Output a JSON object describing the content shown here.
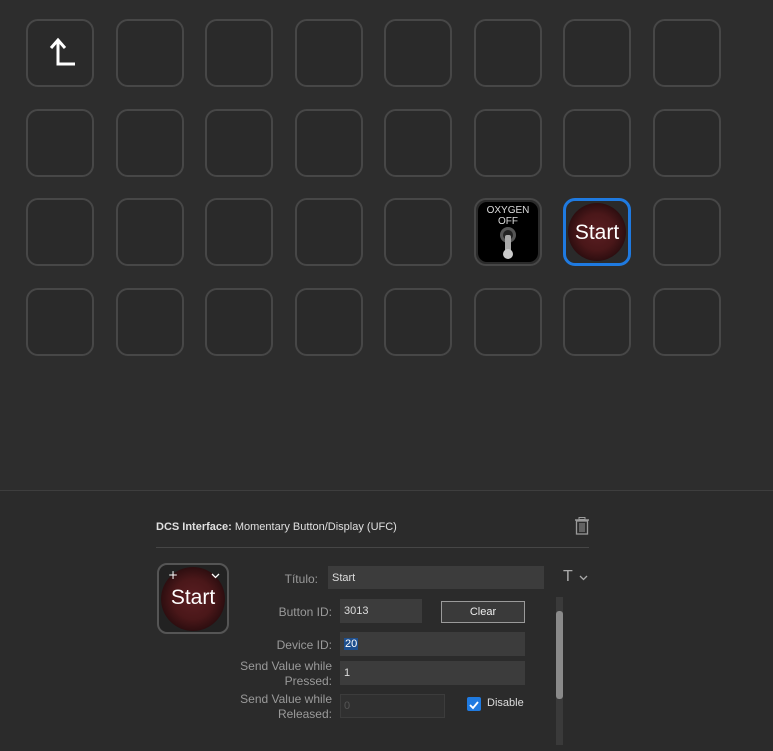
{
  "grid": {
    "oxygen_line1": "OXYGEN",
    "oxygen_line2": "OFF",
    "start_key_title": "Start"
  },
  "panel": {
    "header_bold": "DCS Interface:",
    "header_text": "Momentary Button/Display (UFC)",
    "preview_title": "Start",
    "title_label": "Título:",
    "title_value": "Start",
    "title_icon": "T",
    "button_id_label": "Button ID:",
    "button_id_value": "3013",
    "clear_label": "Clear",
    "device_id_label": "Device ID:",
    "device_id_value": "20",
    "send_pressed_label_1": "Send Value while",
    "send_pressed_label_2": "Pressed:",
    "send_pressed_value": "1",
    "send_released_label_1": "Send Value while",
    "send_released_label_2": "Released:",
    "send_released_value": "0",
    "disable_label": "Disable"
  },
  "colors": {
    "accent": "#1f7ae0"
  }
}
